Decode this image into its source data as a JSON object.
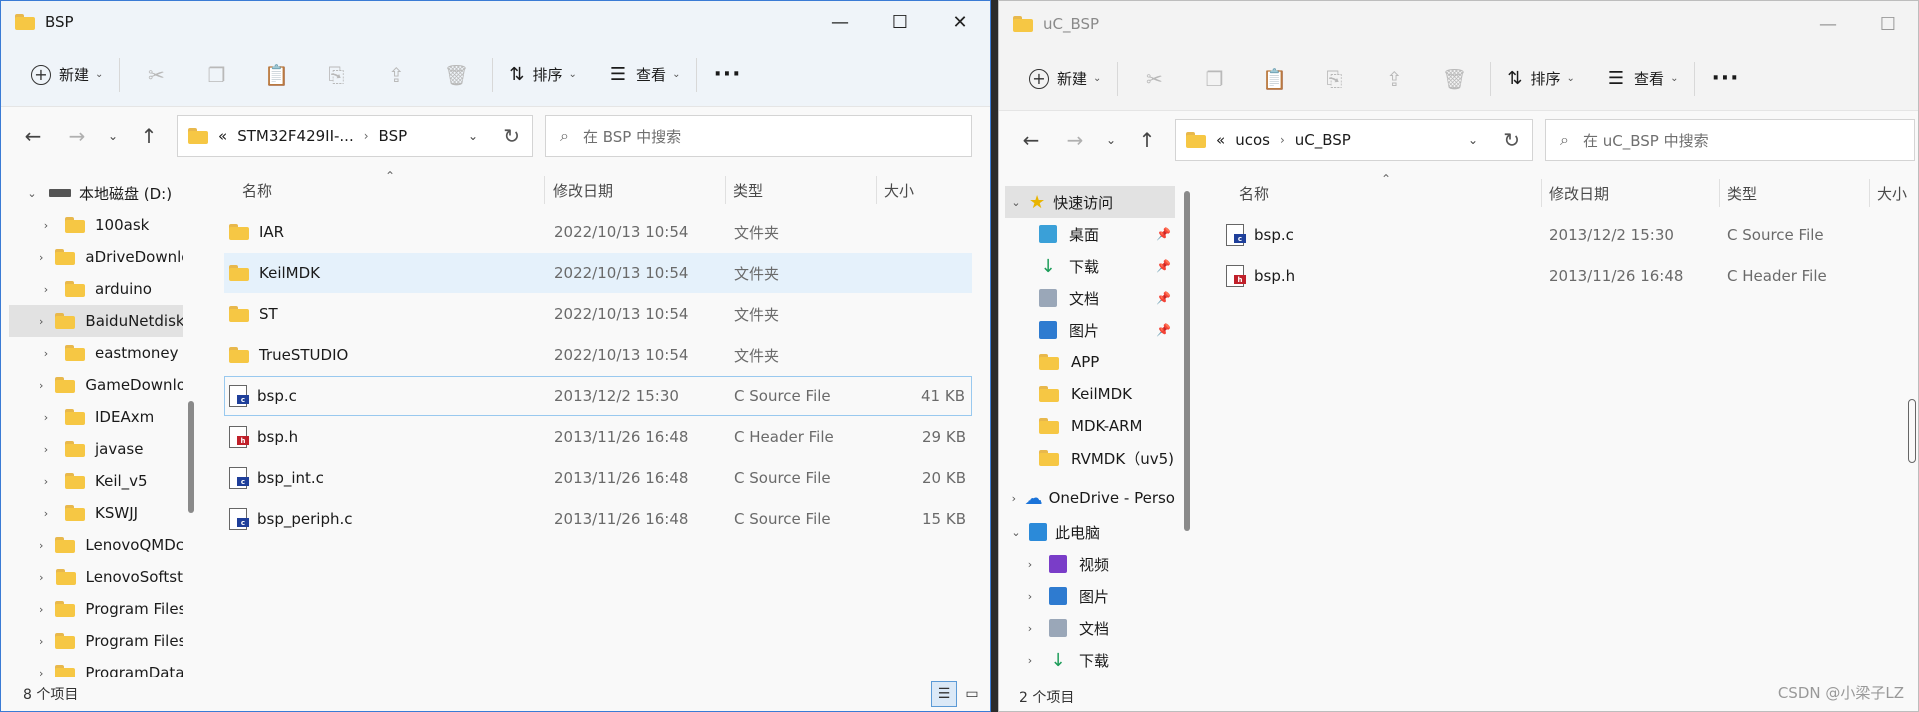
{
  "colors": {
    "accent": "#3a7bd5",
    "folder": "#f6c744",
    "c_file": "#1f3f9a",
    "h_file": "#c0202a",
    "onedrive": "#1a73d9",
    "pc": "#2b8ad9"
  },
  "win1": {
    "title": "BSP",
    "toolbar": {
      "new": "新建",
      "sort": "排序",
      "view": "查看",
      "more": "···"
    },
    "address": {
      "prefix": "«",
      "crumb1": "STM32F429II-...",
      "crumb2": "BSP"
    },
    "search_placeholder": "在 BSP 中搜索",
    "tree": [
      {
        "label": "本地磁盘 (D:)",
        "icon": "drive-icon"
      },
      {
        "label": "100ask"
      },
      {
        "label": "aDriveDownlo"
      },
      {
        "label": "arduino"
      },
      {
        "label": "BaiduNetdiskI"
      },
      {
        "label": "eastmoney"
      },
      {
        "label": "GameDownlo"
      },
      {
        "label": "IDEAxm"
      },
      {
        "label": "javase"
      },
      {
        "label": "Keil_v5"
      },
      {
        "label": "KSWJJ"
      },
      {
        "label": "LenovoQMDc"
      },
      {
        "label": "LenovoSoftst"
      },
      {
        "label": "Program Files"
      },
      {
        "label": "Program Files"
      },
      {
        "label": "ProgramData"
      }
    ],
    "columns": {
      "name": "名称",
      "date": "修改日期",
      "type": "类型",
      "size": "大小"
    },
    "files": [
      {
        "name": "IAR",
        "date": "2022/10/13 10:54",
        "type": "文件夹",
        "size": ""
      },
      {
        "name": "KeilMDK",
        "date": "2022/10/13 10:54",
        "type": "文件夹",
        "size": ""
      },
      {
        "name": "ST",
        "date": "2022/10/13 10:54",
        "type": "文件夹",
        "size": ""
      },
      {
        "name": "TrueSTUDIO",
        "date": "2022/10/13 10:54",
        "type": "文件夹",
        "size": ""
      },
      {
        "name": "bsp.c",
        "date": "2013/12/2 15:30",
        "type": "C Source File",
        "size": "41 KB"
      },
      {
        "name": "bsp.h",
        "date": "2013/11/26 16:48",
        "type": "C Header File",
        "size": "29 KB"
      },
      {
        "name": "bsp_int.c",
        "date": "2013/11/26 16:48",
        "type": "C Source File",
        "size": "20 KB"
      },
      {
        "name": "bsp_periph.c",
        "date": "2013/11/26 16:48",
        "type": "C Source File",
        "size": "15 KB"
      }
    ],
    "status": "8 个项目"
  },
  "win2": {
    "title": "uC_BSP",
    "toolbar": {
      "new": "新建",
      "sort": "排序",
      "view": "查看",
      "more": "···"
    },
    "address": {
      "prefix": "«",
      "crumb1": "ucos",
      "crumb2": "uC_BSP"
    },
    "search_placeholder": "在 uC_BSP 中搜索",
    "tree": [
      {
        "label": "快速访问"
      },
      {
        "label": "桌面"
      },
      {
        "label": "下载"
      },
      {
        "label": "文档"
      },
      {
        "label": "图片"
      },
      {
        "label": "APP"
      },
      {
        "label": "KeilMDK"
      },
      {
        "label": "MDK-ARM"
      },
      {
        "label": "RVMDK（uv5)"
      },
      {
        "label": "OneDrive - Perso"
      },
      {
        "label": "此电脑"
      },
      {
        "label": "视频"
      },
      {
        "label": "图片"
      },
      {
        "label": "文档"
      },
      {
        "label": "下载"
      }
    ],
    "columns": {
      "name": "名称",
      "date": "修改日期",
      "type": "类型",
      "size": "大小"
    },
    "files": [
      {
        "name": "bsp.c",
        "date": "2013/12/2 15:30",
        "type": "C Source File"
      },
      {
        "name": "bsp.h",
        "date": "2013/11/26 16:48",
        "type": "C Header File"
      }
    ],
    "status": "2 个项目"
  },
  "watermark": "CSDN @小梁子LZ"
}
